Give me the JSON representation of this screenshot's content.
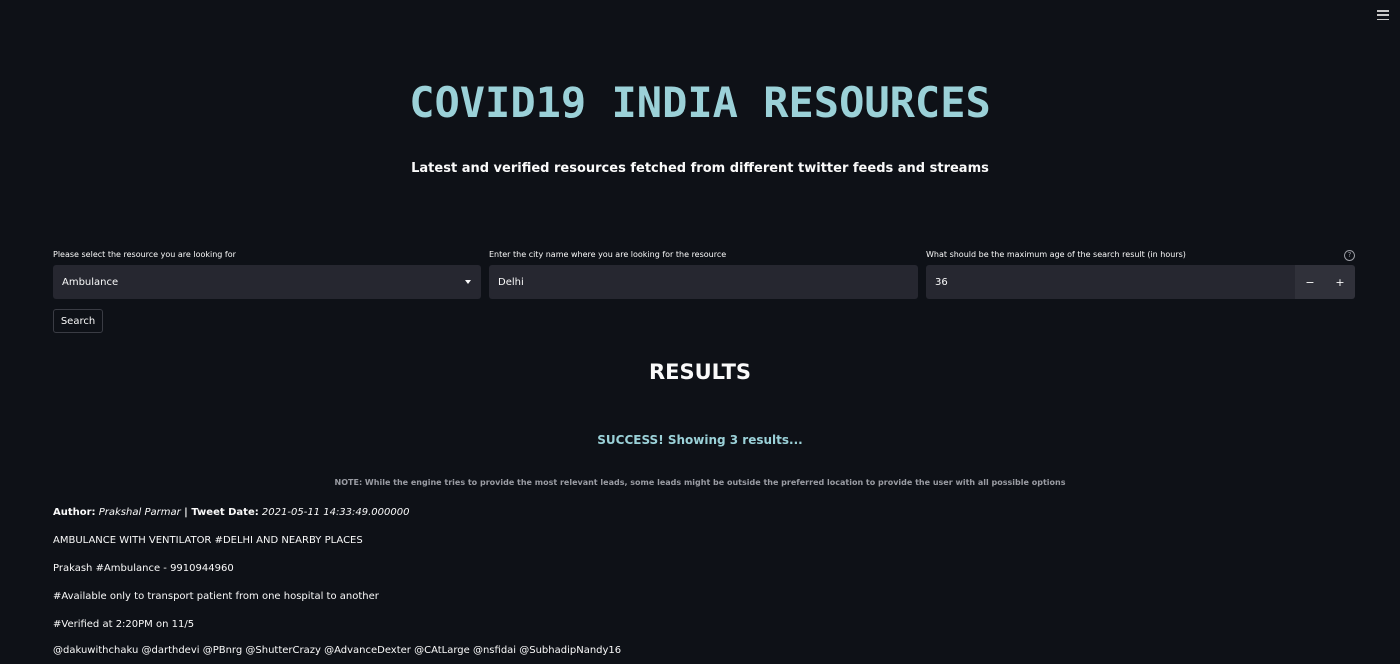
{
  "header": {
    "title": "COVID19 INDIA RESOURCES",
    "subtitle": "Latest and verified resources fetched from different twitter feeds and streams"
  },
  "form": {
    "resource_label": "Please select the resource you are looking for",
    "resource_value": "Ambulance",
    "city_label": "Enter the city name where you are looking for the resource",
    "city_value": "Delhi",
    "age_label": "What should be the maximum age of the search result (in hours)",
    "age_value": "36",
    "minus_label": "−",
    "plus_label": "+",
    "help_glyph": "?",
    "search_label": "Search"
  },
  "results": {
    "heading": "RESULTS",
    "success": "SUCCESS! Showing 3 results...",
    "note": "NOTE: While the engine tries to provide the most relevant leads, some leads might be outside the preferred location to provide the user with all possible options",
    "items": [
      {
        "author_label": "Author:",
        "author": "Prakshal Parmar",
        "separator": " | ",
        "date_label": "Tweet Date:",
        "date": "2021-05-11 14:33:49.000000",
        "lines": [
          "AMBULANCE WITH VENTILATOR #DELHI AND NEARBY PLACES",
          "Prakash #Ambulance - 9910944960",
          "#Available only to transport patient from one hospital to another",
          "#Verified at 2:20PM on 11/5",
          "@dakuwithchaku @darthdevi @PBnrg @ShutterCrazy @AdvanceDexter @CAtLarge @nsfidai @SubhadipNandy16"
        ]
      }
    ]
  },
  "colors": {
    "background": "#0e1117",
    "accent": "#9bd1d8",
    "input": "#262730"
  },
  "icons": [
    "hamburger-menu-icon",
    "help-icon",
    "chevron-down-icon"
  ]
}
